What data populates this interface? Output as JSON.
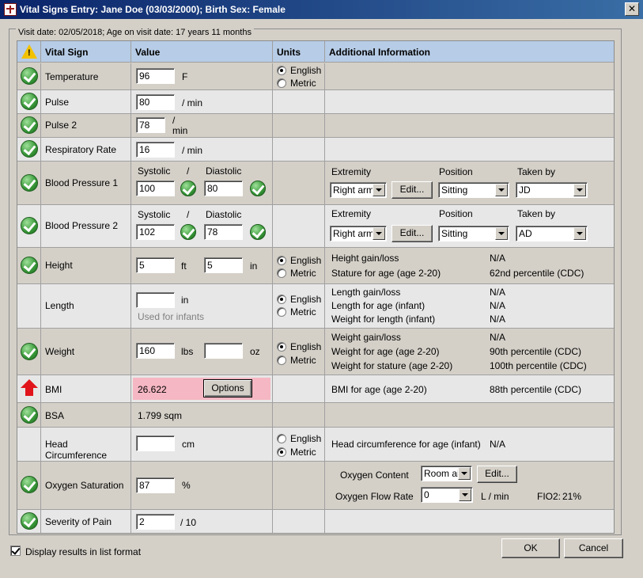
{
  "window": {
    "title": "Vital Signs Entry: Jane Doe (03/03/2000); Birth Sex: Female",
    "close_glyph": "✕"
  },
  "visit_label": "Visit date: 02/05/2018; Age on visit date: 17 years 11 months",
  "headers": {
    "warn_glyph": "!",
    "vital_sign": "Vital Sign",
    "value": "Value",
    "units": "Units",
    "additional": "Additional Information"
  },
  "units_options": {
    "english": "English",
    "metric": "Metric"
  },
  "rows": {
    "temperature": {
      "name": "Temperature",
      "value": "96",
      "unit": "F",
      "units_selected": "English"
    },
    "pulse": {
      "name": "Pulse",
      "value": "80",
      "unit": "/  min"
    },
    "pulse2": {
      "name": "Pulse 2",
      "value": "78",
      "unit_top": "/",
      "unit_bottom": "min"
    },
    "resp": {
      "name": "Respiratory Rate",
      "value": "16",
      "unit": "/  min"
    },
    "bp1": {
      "name": "Blood Pressure 1",
      "systolic_label": "Systolic",
      "slash": "/",
      "diastolic_label": "Diastolic",
      "systolic": "100",
      "diastolic": "80",
      "extremity_label": "Extremity",
      "position_label": "Position",
      "taken_by_label": "Taken by",
      "extremity": "Right arm",
      "edit": "Edit...",
      "position": "Sitting",
      "taken_by": "JD"
    },
    "bp2": {
      "name": "Blood Pressure 2",
      "systolic_label": "Systolic",
      "slash": "/",
      "diastolic_label": "Diastolic",
      "systolic": "102",
      "diastolic": "78",
      "extremity_label": "Extremity",
      "position_label": "Position",
      "taken_by_label": "Taken by",
      "extremity": "Right arm",
      "edit": "Edit...",
      "position": "Sitting",
      "taken_by": "AD"
    },
    "height": {
      "name": "Height",
      "ft_value": "5",
      "ft": "ft",
      "in_value": "5",
      "in": "in",
      "units_selected": "English",
      "info": [
        {
          "label": "Height gain/loss",
          "value": "N/A"
        },
        {
          "label": "Stature for age (age 2-20)",
          "value": "62nd percentile (CDC)"
        }
      ]
    },
    "length": {
      "name": "Length",
      "value": "",
      "unit": "in",
      "hint": "Used for infants",
      "units_selected": "English",
      "info": [
        {
          "label": "Length gain/loss",
          "value": "N/A"
        },
        {
          "label": "Length for age (infant)",
          "value": "N/A"
        },
        {
          "label": "Weight for length (infant)",
          "value": "N/A"
        }
      ]
    },
    "weight": {
      "name": "Weight",
      "lbs_value": "160",
      "lbs": "lbs",
      "oz_value": "",
      "oz": "oz",
      "units_selected": "English",
      "info": [
        {
          "label": "Weight gain/loss",
          "value": "N/A"
        },
        {
          "label": "Weight for age (age 2-20)",
          "value": "90th percentile (CDC)"
        },
        {
          "label": "Weight for stature (age 2-20)",
          "value": "100th percentile (CDC)"
        }
      ]
    },
    "bmi": {
      "name": "BMI",
      "value": "26.622",
      "options": "Options",
      "info": [
        {
          "label": "BMI for age (age 2-20)",
          "value": "88th percentile (CDC)"
        }
      ]
    },
    "bsa": {
      "name": "BSA",
      "value": "1.799 sqm"
    },
    "head": {
      "name": "Head Circumference",
      "value": "",
      "unit": "cm",
      "units_selected": "Metric",
      "info": [
        {
          "label": "Head circumference for age (infant)",
          "value": "N/A"
        }
      ]
    },
    "oxygen": {
      "name": "Oxygen Saturation",
      "value": "87",
      "unit": "%",
      "content_label": "Oxygen Content",
      "content": "Room air",
      "edit": "Edit...",
      "flow_label": "Oxygen Flow Rate",
      "flow": "0",
      "flow_unit": "L / min",
      "fio2_label": "FIO2:",
      "fio2": "21%"
    },
    "pain": {
      "name": "Severity of Pain",
      "value": "2",
      "unit": "/ 10"
    }
  },
  "footer": {
    "list_format": "Display results in list format",
    "list_format_checked": true,
    "ok": "OK",
    "cancel": "Cancel"
  }
}
